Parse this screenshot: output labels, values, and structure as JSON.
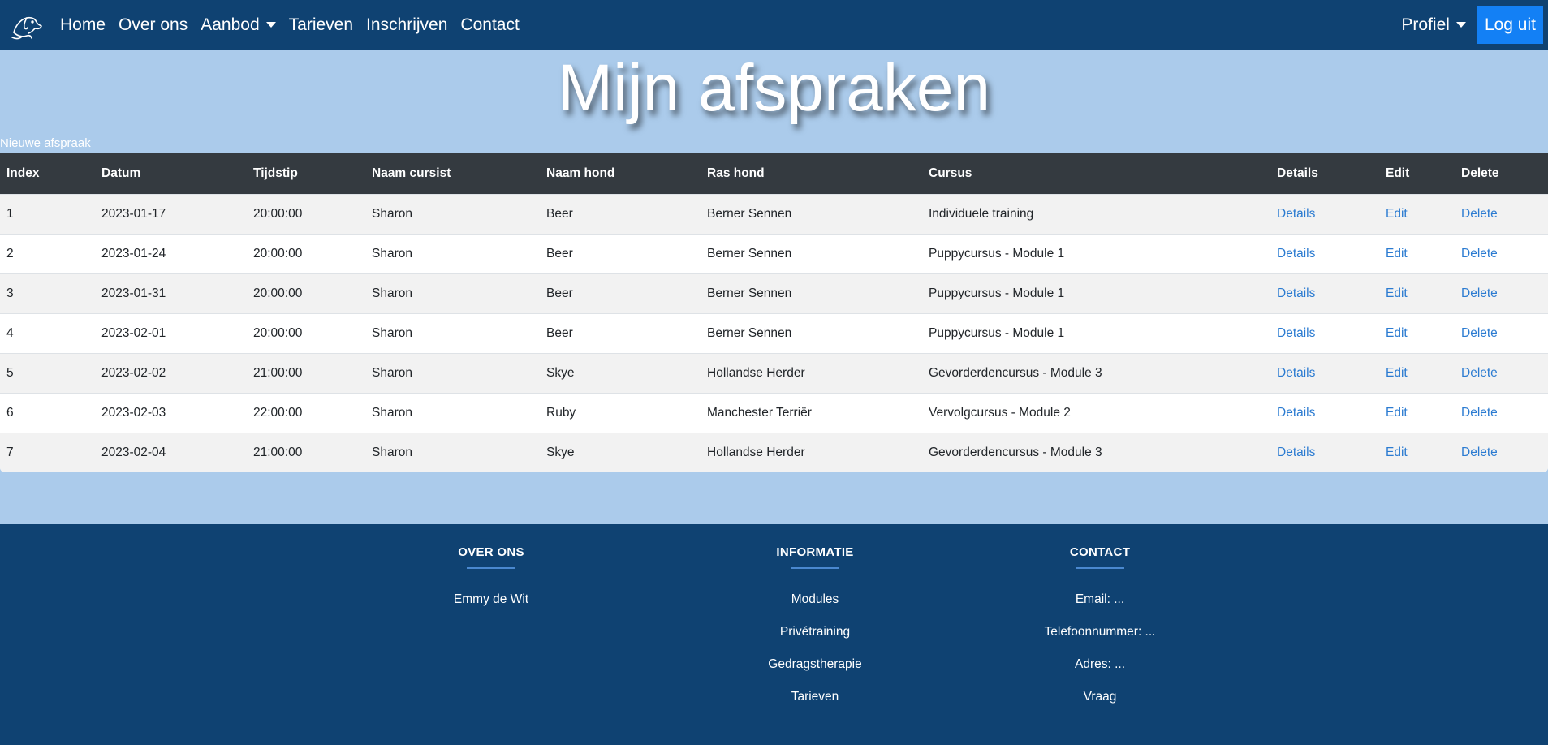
{
  "nav": {
    "items": [
      {
        "label": "Home"
      },
      {
        "label": "Over ons"
      },
      {
        "label": "Aanbod"
      },
      {
        "label": "Tarieven"
      },
      {
        "label": "Inschrijven"
      },
      {
        "label": "Contact"
      }
    ],
    "profile_label": "Profiel",
    "logout_label": "Log uit"
  },
  "page": {
    "title": "Mijn afspraken",
    "new_link": "Nieuwe afspraak"
  },
  "table": {
    "headers": [
      "Index",
      "Datum",
      "Tijdstip",
      "Naam cursist",
      "Naam hond",
      "Ras hond",
      "Cursus",
      "Details",
      "Edit",
      "Delete"
    ],
    "rows": [
      {
        "index": "1",
        "datum": "2023-01-17",
        "tijdstip": "20:00:00",
        "cursist": "Sharon",
        "hond": "Beer",
        "ras": "Berner Sennen",
        "cursus": "Individuele training",
        "details": "Details",
        "edit": "Edit",
        "delete": "Delete"
      },
      {
        "index": "2",
        "datum": "2023-01-24",
        "tijdstip": "20:00:00",
        "cursist": "Sharon",
        "hond": "Beer",
        "ras": "Berner Sennen",
        "cursus": "Puppycursus - Module 1",
        "details": "Details",
        "edit": "Edit",
        "delete": "Delete"
      },
      {
        "index": "3",
        "datum": "2023-01-31",
        "tijdstip": "20:00:00",
        "cursist": "Sharon",
        "hond": "Beer",
        "ras": "Berner Sennen",
        "cursus": "Puppycursus - Module 1",
        "details": "Details",
        "edit": "Edit",
        "delete": "Delete"
      },
      {
        "index": "4",
        "datum": "2023-02-01",
        "tijdstip": "20:00:00",
        "cursist": "Sharon",
        "hond": "Beer",
        "ras": "Berner Sennen",
        "cursus": "Puppycursus - Module 1",
        "details": "Details",
        "edit": "Edit",
        "delete": "Delete"
      },
      {
        "index": "5",
        "datum": "2023-02-02",
        "tijdstip": "21:00:00",
        "cursist": "Sharon",
        "hond": "Skye",
        "ras": "Hollandse Herder",
        "cursus": "Gevorderdencursus - Module 3",
        "details": "Details",
        "edit": "Edit",
        "delete": "Delete"
      },
      {
        "index": "6",
        "datum": "2023-02-03",
        "tijdstip": "22:00:00",
        "cursist": "Sharon",
        "hond": "Ruby",
        "ras": "Manchester Terriër",
        "cursus": "Vervolgcursus - Module 2",
        "details": "Details",
        "edit": "Edit",
        "delete": "Delete"
      },
      {
        "index": "7",
        "datum": "2023-02-04",
        "tijdstip": "21:00:00",
        "cursist": "Sharon",
        "hond": "Skye",
        "ras": "Hollandse Herder",
        "cursus": "Gevorderdencursus - Module 3",
        "details": "Details",
        "edit": "Edit",
        "delete": "Delete"
      }
    ]
  },
  "footer": {
    "over_ons": {
      "heading": "OVER ONS",
      "items": [
        "Emmy de Wit"
      ]
    },
    "informatie": {
      "heading": "INFORMATIE",
      "items": [
        "Modules",
        "Privétraining",
        "Gedragstherapie",
        "Tarieven"
      ]
    },
    "contact": {
      "heading": "CONTACT",
      "items": [
        "Email: ...",
        "Telefoonnummer: ...",
        "Adres: ...",
        "Vraag"
      ]
    }
  },
  "colors": {
    "navbar": "#0f4272",
    "page_bg": "#abcbeb",
    "table_header": "#343a40",
    "logout_btn": "#1380f5",
    "link": "#2b7bd1"
  },
  "icons": {
    "logo": "dog-logo-icon",
    "dropdown": "caret-down-icon"
  }
}
